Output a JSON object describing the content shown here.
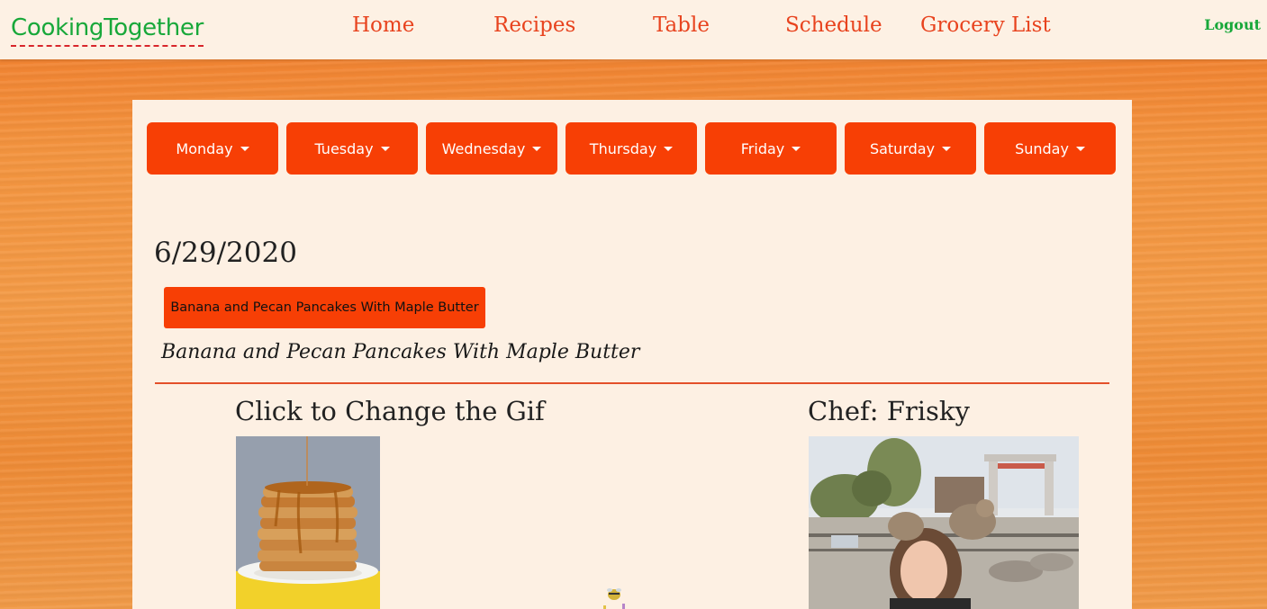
{
  "nav": {
    "brand": "CookingTogether",
    "links": [
      "Home",
      "Recipes",
      "Table",
      "Schedule",
      "Grocery List"
    ],
    "logout": "Logout"
  },
  "days": [
    "Monday",
    "Tuesday",
    "Wednesday",
    "Thursday",
    "Friday",
    "Saturday",
    "Sunday"
  ],
  "content": {
    "date": "6/29/2020",
    "recipe_button": "Banana and Pecan Pancakes With Maple Butter",
    "recipe_title": "Banana and Pecan Pancakes With Maple Butter",
    "gif_heading": "Click to Change the Gif",
    "chef_heading": "Chef: Frisky"
  },
  "colors": {
    "accent": "#f73f05",
    "brand_green": "#18a83a",
    "nav_link": "#e8431e"
  }
}
